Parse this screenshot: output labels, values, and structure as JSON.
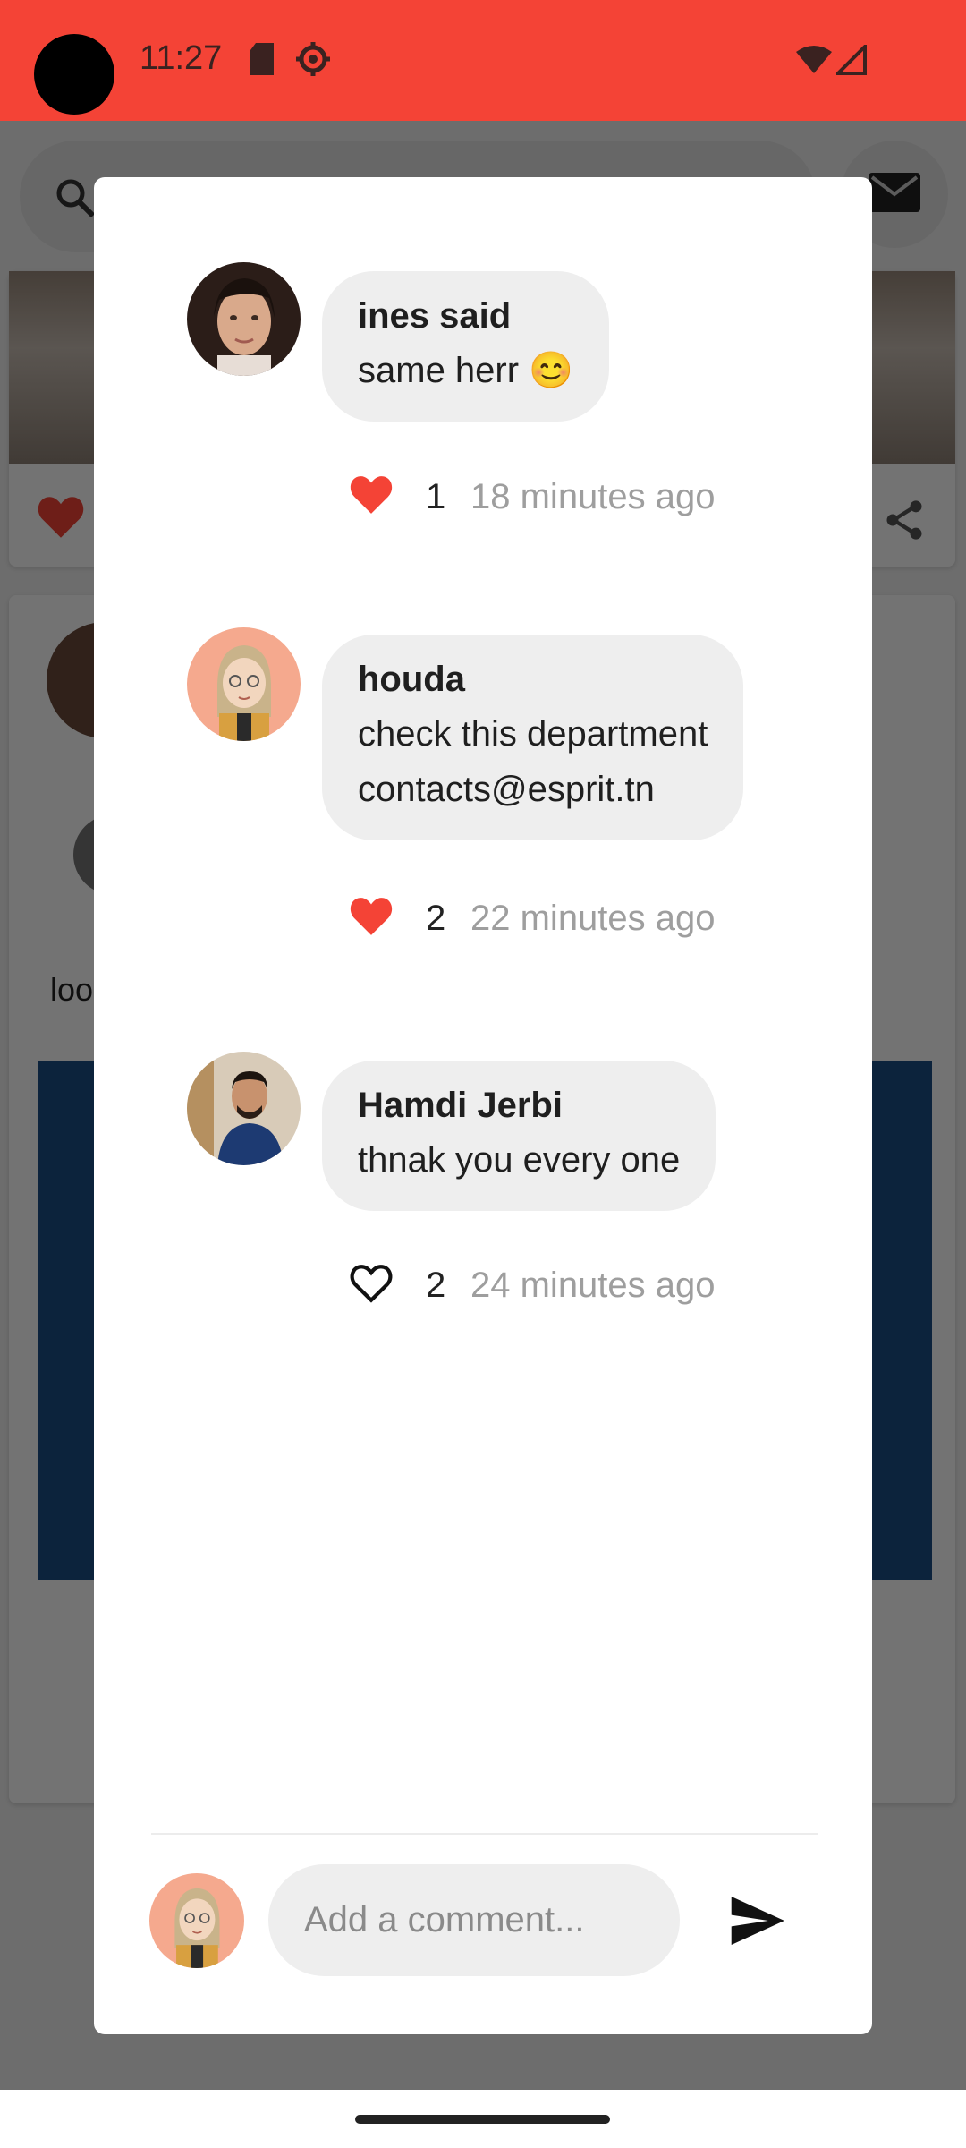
{
  "status_bar": {
    "time": "11:27",
    "background": "#F44336",
    "icons": [
      "sd-card-icon",
      "settings-gear-icon",
      "wifi-icon",
      "cellular-signal-icon"
    ]
  },
  "dialog": {
    "comments": [
      {
        "author": "ines said",
        "text_lines": [
          "same herr 😊"
        ],
        "liked": true,
        "likes": "1",
        "time_ago": "18 minutes ago"
      },
      {
        "author": "houda",
        "text_lines": [
          "check this department",
          "contacts@esprit.tn"
        ],
        "liked": true,
        "likes": "2",
        "time_ago": "22 minutes ago"
      },
      {
        "author": "Hamdi Jerbi",
        "text_lines": [
          "thnak you every one"
        ],
        "liked": false,
        "likes": "2",
        "time_ago": "24 minutes ago"
      }
    ],
    "composer": {
      "placeholder": "Add a comment...",
      "send_icon": "send-icon"
    }
  },
  "background_app": {
    "snippet_text": "loo"
  },
  "colors": {
    "accent": "#F44336",
    "bubble": "#EEEEEE",
    "muted_text": "#9E9E9E"
  }
}
